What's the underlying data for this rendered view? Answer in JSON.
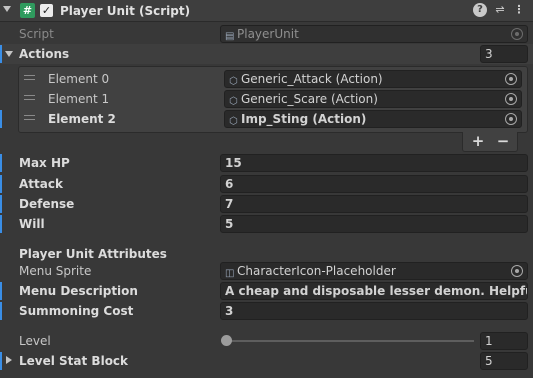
{
  "header": {
    "title": "Player Unit (Script)",
    "enabled": true,
    "script_icon": "csharp-script-icon",
    "icons": [
      "help-icon",
      "presets-icon",
      "more-icon"
    ]
  },
  "script": {
    "label": "Script",
    "value": "PlayerUnit"
  },
  "actions": {
    "label": "Actions",
    "size": "3",
    "elements": [
      {
        "label": "Element 0",
        "value": "Generic_Attack (Action)"
      },
      {
        "label": "Element 1",
        "value": "Generic_Scare (Action)"
      },
      {
        "label": "Element 2",
        "value": "Imp_Sting (Action)"
      }
    ],
    "add_label": "+",
    "remove_label": "−"
  },
  "stats": [
    {
      "label": "Max HP",
      "value": "15"
    },
    {
      "label": "Attack",
      "value": "6"
    },
    {
      "label": "Defense",
      "value": "7"
    },
    {
      "label": "Will",
      "value": "5"
    }
  ],
  "attributes": {
    "heading": "Player Unit Attributes",
    "menu_sprite": {
      "label": "Menu Sprite",
      "value": "CharacterIcon-Placeholder"
    },
    "menu_description": {
      "label": "Menu Description",
      "value": "A cheap and disposable lesser demon. Helpful for fi"
    },
    "summoning_cost": {
      "label": "Summoning Cost",
      "value": "3"
    }
  },
  "level": {
    "label": "Level",
    "value": "1",
    "slider_fraction": 0
  },
  "level_stat_block": {
    "label": "Level Stat Block",
    "value": "5"
  },
  "colors": {
    "accent": "#3a8ee6",
    "background": "#383838",
    "field": "#2a2a2a",
    "script_icon": "#2f9b5e"
  }
}
